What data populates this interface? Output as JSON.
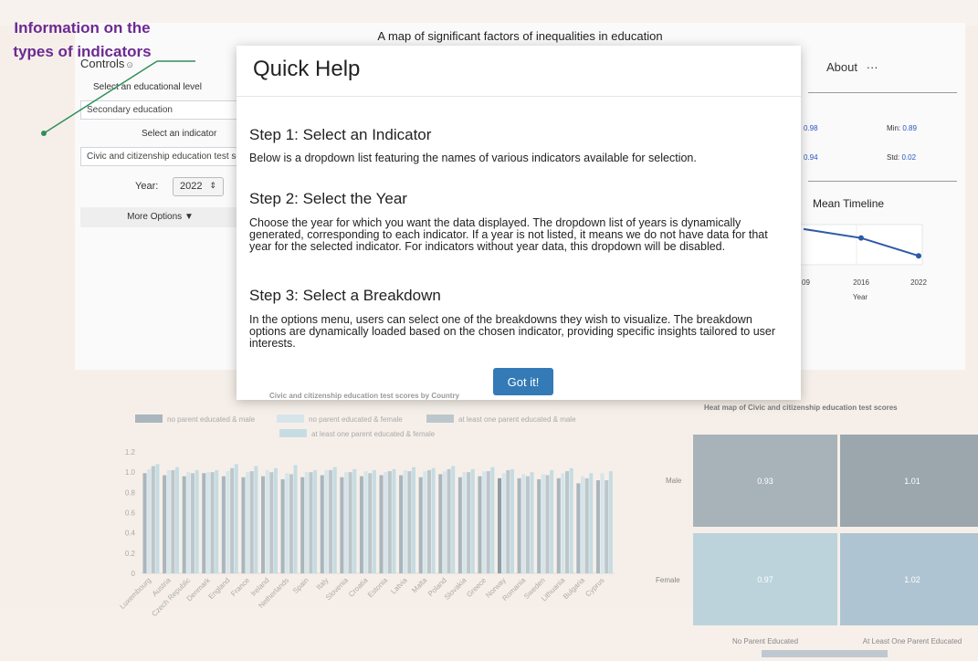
{
  "annotation": {
    "text": "Information on the types of indicators"
  },
  "app": {
    "title": "A map of significant factors of inequalities in education"
  },
  "controls": {
    "title": "Controls",
    "level_label": "Select an educational level",
    "level_value": "Secondary education",
    "indicator_label": "Select an indicator",
    "indicator_value": "Civic and citizenship education test scores",
    "year_label": "Year:",
    "year_value": "2022",
    "more_options": "More Options ▼"
  },
  "about": {
    "label": "About",
    "dots": "···",
    "stats": [
      {
        "key": "",
        "value": "0.98"
      },
      {
        "key": "Min:",
        "value": "0.89"
      },
      {
        "key": "",
        "value": "0.94"
      },
      {
        "key": "Std:",
        "value": "0.02"
      }
    ],
    "timeline_title": "Mean Timeline"
  },
  "modal": {
    "title": "Quick Help",
    "steps": [
      {
        "heading": "Step 1: Select an Indicator",
        "body": "Below is a dropdown list featuring the names of various indicators available for selection."
      },
      {
        "heading": "Step 2: Select the Year",
        "body": "Choose the year for which you want the data displayed. The dropdown list of years is dynamically generated, corresponding to each indicator. If a year is not listed, it means we do not have data for that year for the selected indicator. For indicators without year data, this dropdown will be disabled."
      },
      {
        "heading": "Step 3: Select a Breakdown",
        "body": "In the options menu, users can select one of the breakdowns they wish to visualize. The breakdown options are dynamically loaded based on the chosen indicator, providing specific insights tailored to user interests."
      }
    ],
    "button": "Got it!"
  },
  "heatmap": {
    "title": "Heat map of Civic and citizenship education test scores",
    "rows": [
      "Male",
      "Female"
    ],
    "cols": [
      "No Parent Educated",
      "At Least One Parent Educated"
    ],
    "values": [
      [
        "0.93",
        "1.01"
      ],
      [
        "0.97",
        "1.02"
      ]
    ]
  },
  "colors": {
    "accent": "#337ab7",
    "annotation": "#6b2a92",
    "annotation_line": "#2f8f5b"
  },
  "chart_data": [
    {
      "type": "line",
      "title": "Mean Timeline",
      "xlabel": "Year",
      "x": [
        "09",
        "2016",
        "2022"
      ],
      "tick_labels": [
        "09",
        "2016",
        "2022"
      ],
      "series": [
        {
          "values": [
            1.0,
            0.98,
            0.94
          ]
        }
      ],
      "ylim": [
        0.92,
        1.01
      ]
    },
    {
      "type": "bar",
      "title": "Civic and citizenship education test scores by Country",
      "categories": [
        "Luxembourg",
        "Austria",
        "Czech Republic",
        "Denmark",
        "England",
        "France",
        "Ireland",
        "Netherlands",
        "Spain",
        "Italy",
        "Slovenia",
        "Croatia",
        "Estonia",
        "Latvia",
        "Malta",
        "Poland",
        "Slovakia",
        "Greece",
        "Norway",
        "Romania",
        "Sweden",
        "Lithuania",
        "Bulgaria",
        "Cyprus"
      ],
      "ylim": [
        0,
        1.2
      ],
      "yticks": [
        "0",
        "0.2",
        "0.4",
        "0.6",
        "0.8",
        "1.0",
        "1.2"
      ],
      "series": [
        {
          "name": "no parent educated & male",
          "color": "#aab6bd",
          "values": [
            0.99,
            0.97,
            0.96,
            0.99,
            0.96,
            0.95,
            0.96,
            0.93,
            0.95,
            0.97,
            0.95,
            0.96,
            0.97,
            0.97,
            0.95,
            0.98,
            0.95,
            0.96,
            0.94,
            0.94,
            0.93,
            0.94,
            0.89,
            0.92
          ]
        },
        {
          "name": "no parent educated & female",
          "color": "#d6e5ea",
          "values": [
            1.03,
            1.02,
            1.0,
            1.0,
            1.01,
            1.0,
            1.02,
            0.99,
            1.0,
            1.02,
            1.0,
            1.01,
            1.0,
            1.02,
            1.01,
            1.01,
            1.0,
            1.01,
            0.99,
            0.98,
            0.98,
            0.99,
            0.96,
            0.99
          ]
        },
        {
          "name": "at least one parent educated & male",
          "color": "#bcc7cc",
          "values": [
            1.06,
            1.02,
            0.99,
            1.0,
            1.04,
            1.01,
            1.0,
            0.98,
            1.0,
            1.02,
            1.0,
            0.99,
            1.01,
            1.01,
            1.02,
            1.03,
            1.0,
            1.01,
            1.02,
            0.96,
            0.97,
            1.01,
            0.94,
            0.92
          ]
        },
        {
          "name": "at least one parent educated & female",
          "color": "#c6dce3",
          "values": [
            1.08,
            1.05,
            1.02,
            1.02,
            1.08,
            1.06,
            1.04,
            1.07,
            1.02,
            1.05,
            1.03,
            1.02,
            1.03,
            1.05,
            1.04,
            1.06,
            1.03,
            1.05,
            1.03,
            1.0,
            1.02,
            1.04,
            0.99,
            1.01
          ]
        }
      ]
    }
  ]
}
